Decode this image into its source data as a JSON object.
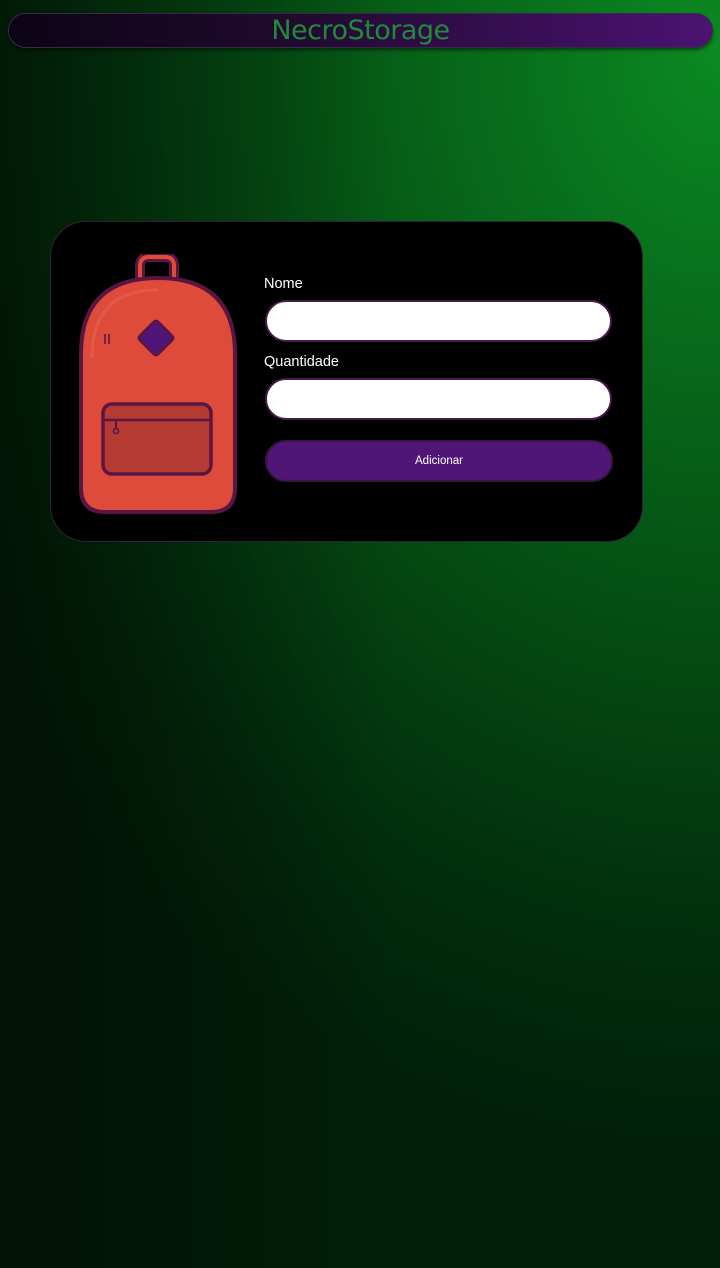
{
  "app": {
    "title": "NecroStorage"
  },
  "form": {
    "nome_label": "Nome",
    "nome_value": "",
    "quantidade_label": "Quantidade",
    "quantidade_value": "",
    "submit_label": "Adicionar"
  },
  "illustration": {
    "icon": "backpack-icon"
  },
  "colors": {
    "title_text": "#1f8a3c",
    "header_bar": "#4a1470",
    "card_background": "#000000",
    "button_background": "#4f1677",
    "backpack_body": "#df4b3a",
    "backpack_outline": "#5a1640",
    "backpack_patch": "#4f1677",
    "background_green": "#0b8a22"
  }
}
